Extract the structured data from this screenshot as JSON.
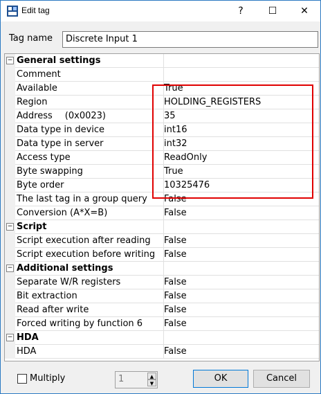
{
  "window": {
    "title": "Edit tag",
    "help_symbol": "?",
    "maximize_symbol": "☐",
    "close_symbol": "✕"
  },
  "tag_name": {
    "label": "Tag name",
    "value": "Discrete Input 1"
  },
  "categories": [
    {
      "title": "General settings",
      "rows": [
        {
          "name": "Comment",
          "value": ""
        },
        {
          "name": "Available",
          "value": "True"
        },
        {
          "name": "Region",
          "value": "HOLDING_REGISTERS"
        },
        {
          "name": "Address",
          "extra": "(0x0023)",
          "value": "35"
        },
        {
          "name": "Data type in device",
          "value": "int16"
        },
        {
          "name": "Data type in server",
          "value": "int32"
        },
        {
          "name": "Access type",
          "value": "ReadOnly"
        },
        {
          "name": "Byte swapping",
          "value": "True"
        },
        {
          "name": "Byte order",
          "value": "10325476"
        },
        {
          "name": "The last tag in a group query",
          "value": "False"
        },
        {
          "name": "Conversion (A*X=B)",
          "value": "False"
        }
      ]
    },
    {
      "title": "Script",
      "rows": [
        {
          "name": "Script execution after reading",
          "value": "False"
        },
        {
          "name": "Script execution before writing",
          "value": "False"
        }
      ]
    },
    {
      "title": "Additional settings",
      "rows": [
        {
          "name": "Separate W/R registers",
          "value": "False"
        },
        {
          "name": "Bit extraction",
          "value": "False"
        },
        {
          "name": "Read after write",
          "value": "False"
        },
        {
          "name": "Forced writing by function 6",
          "value": "False"
        }
      ]
    },
    {
      "title": "HDA",
      "rows": [
        {
          "name": "HDA",
          "value": "False"
        }
      ]
    }
  ],
  "footer": {
    "multiply_label": "Multiply",
    "multiply_checked": false,
    "spin_value": "1",
    "ok_label": "OK",
    "cancel_label": "Cancel"
  },
  "colors": {
    "highlight": "#e00000",
    "accent": "#0078d7"
  }
}
